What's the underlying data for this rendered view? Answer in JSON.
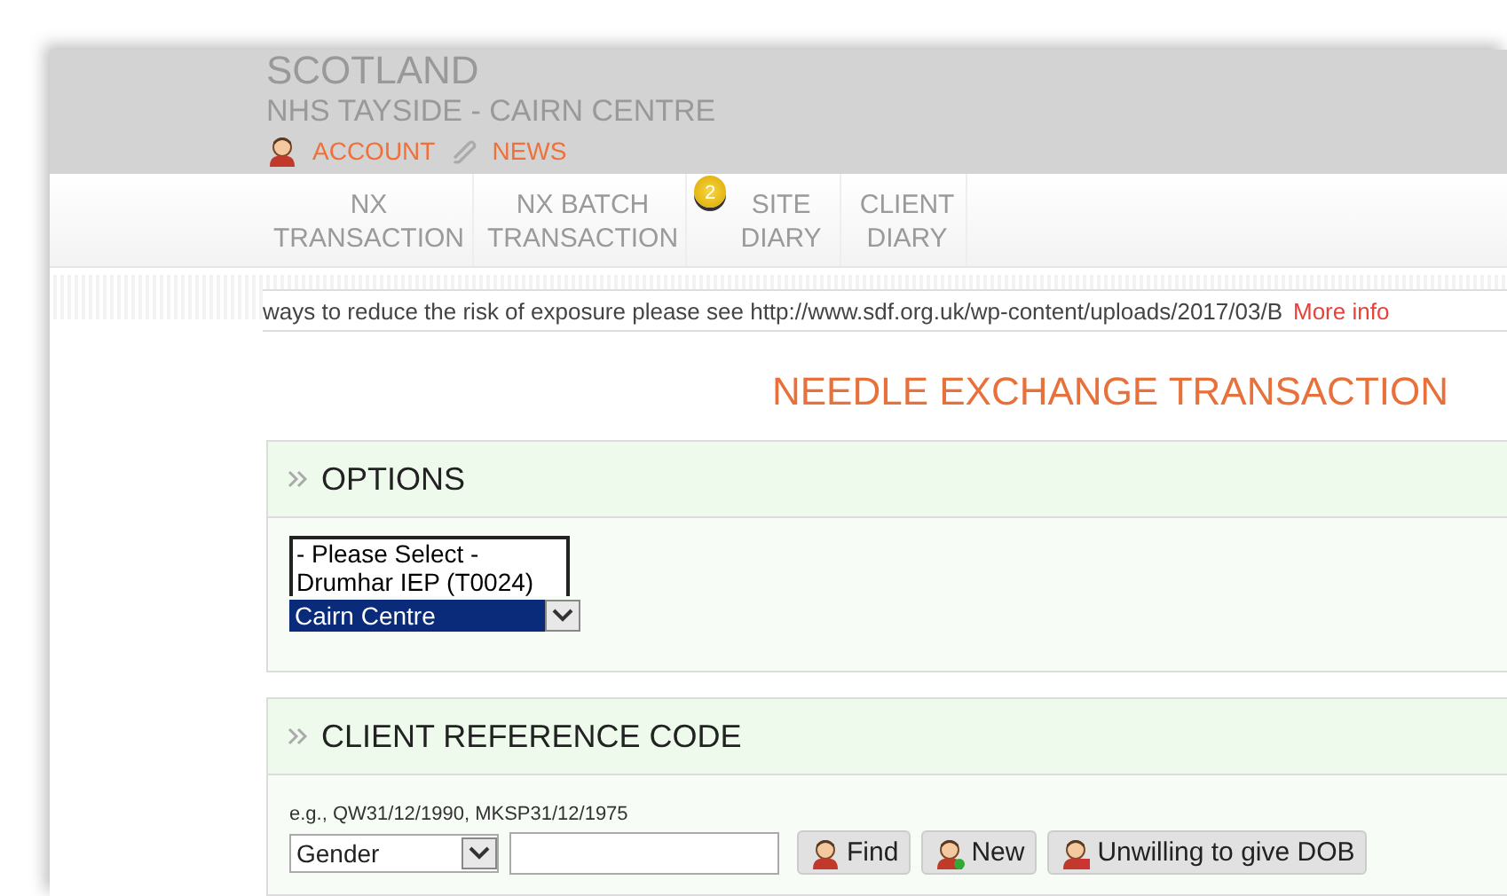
{
  "header": {
    "region": "SCOTLAND",
    "site": "NHS TAYSIDE - CAIRN CENTRE",
    "links": [
      {
        "kind": "account",
        "label": "ACCOUNT"
      },
      {
        "kind": "news",
        "label": "NEWS"
      }
    ]
  },
  "nav": {
    "tabs": [
      {
        "line1": "NX",
        "line2": "TRANSACTION"
      },
      {
        "line1": "NX BATCH",
        "line2": "TRANSACTION"
      },
      {
        "line1": "SITE",
        "line2": "DIARY",
        "badge": "2"
      },
      {
        "line1": "CLIENT",
        "line2": "DIARY"
      }
    ]
  },
  "ticker": {
    "text": "ways to reduce the risk of exposure please see http://www.sdf.org.uk/wp-content/uploads/2017/03/B",
    "link": "More info"
  },
  "page_title": "NEEDLE EXCHANGE TRANSACTION",
  "options": {
    "title": "OPTIONS",
    "site_select": {
      "options": [
        {
          "label": "- Please Select -",
          "selected": false
        },
        {
          "label": "Drumhar IEP (T0024)",
          "selected": false
        },
        {
          "label": "Cairn Centre",
          "selected": true
        }
      ]
    }
  },
  "client_reference": {
    "title": "CLIENT REFERENCE CODE",
    "hint": "e.g., QW31/12/1990, MKSP31/12/1975",
    "gender_select": "Gender",
    "buttons": [
      {
        "kind": "find",
        "label": "Find"
      },
      {
        "kind": "new",
        "label": "New"
      },
      {
        "kind": "unwilling",
        "label": "Unwilling to give DOB"
      }
    ]
  }
}
